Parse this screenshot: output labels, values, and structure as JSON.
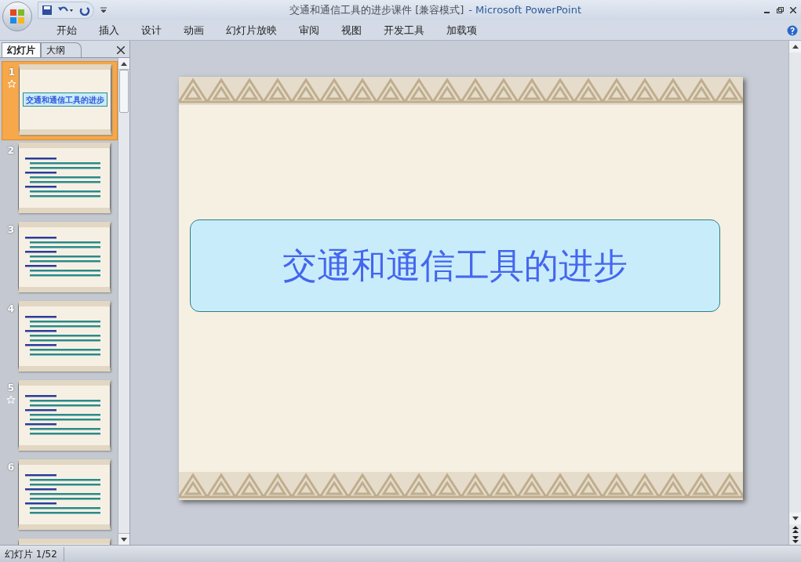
{
  "window": {
    "document_title": "交通和通信工具的进步课件 [兼容模式]",
    "app_title": "- Microsoft PowerPoint"
  },
  "ribbon_tabs": [
    {
      "label": "开始"
    },
    {
      "label": "插入"
    },
    {
      "label": "设计"
    },
    {
      "label": "动画"
    },
    {
      "label": "幻灯片放映"
    },
    {
      "label": "审阅"
    },
    {
      "label": "视图"
    },
    {
      "label": "开发工具"
    },
    {
      "label": "加载项"
    }
  ],
  "panel_tabs": [
    {
      "label": "幻灯片",
      "selected": true
    },
    {
      "label": "大纲",
      "selected": false
    }
  ],
  "thumbnails": [
    {
      "number": "1",
      "selected": true,
      "animated": true,
      "title": "交通和通信工具的进步"
    },
    {
      "number": "2",
      "selected": false,
      "animated": false
    },
    {
      "number": "3",
      "selected": false,
      "animated": false
    },
    {
      "number": "4",
      "selected": false,
      "animated": false
    },
    {
      "number": "5",
      "selected": false,
      "animated": true
    },
    {
      "number": "6",
      "selected": false,
      "animated": false
    },
    {
      "selected": false,
      "animated": false
    }
  ],
  "slide": {
    "title": "交通和通信工具的进步"
  },
  "status_bar": {
    "slide_indicator": "幻灯片 1/52"
  }
}
